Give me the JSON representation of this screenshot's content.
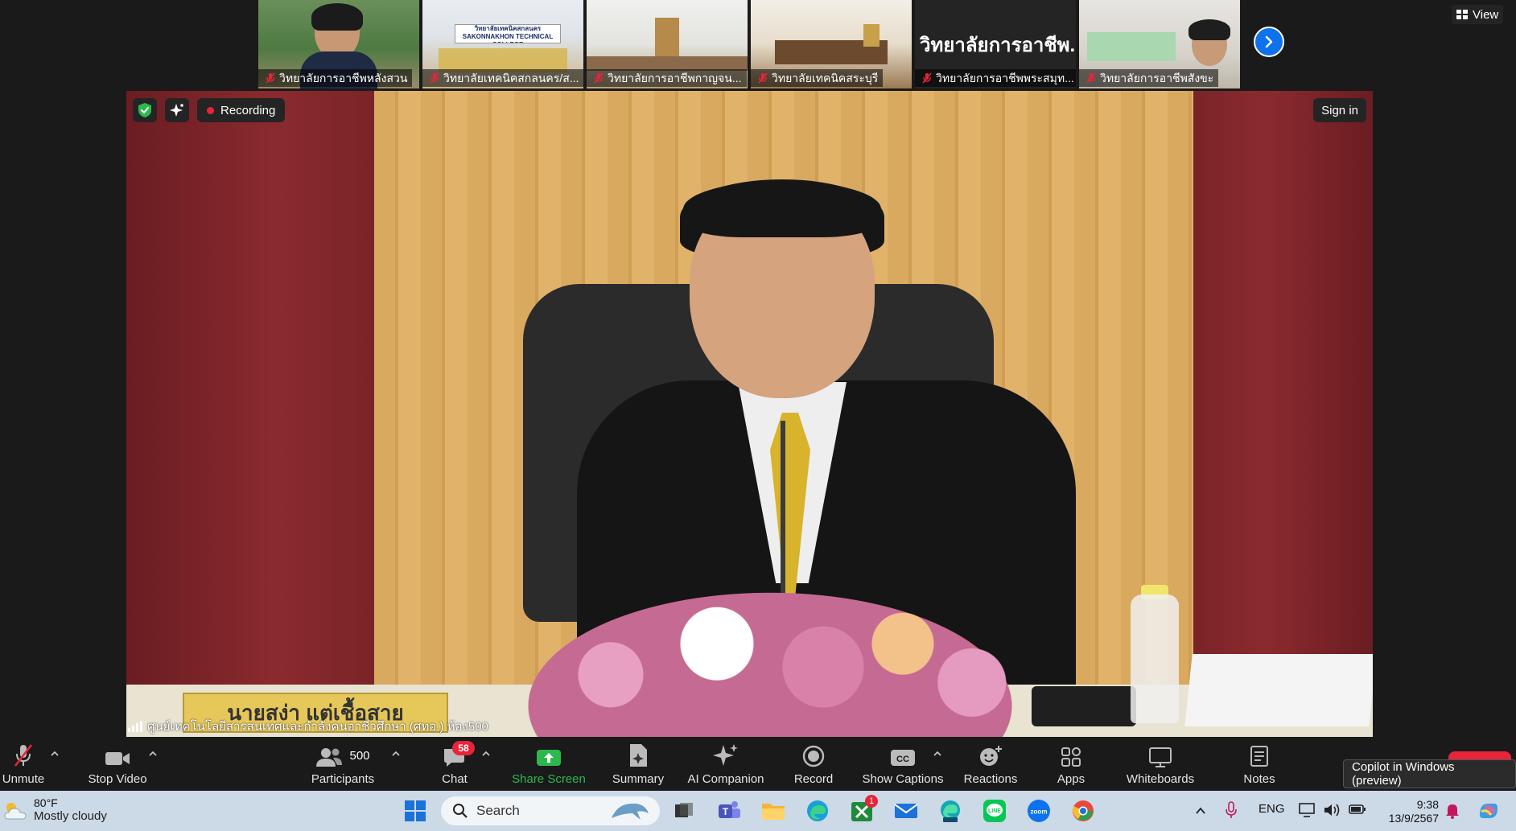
{
  "thumbnails": [
    {
      "label": "วิทยาลัยการอาชีพหลังสวน",
      "muted": true
    },
    {
      "label": "วิทยาลัยเทคนิคสกลนคร/ส...",
      "muted": true
    },
    {
      "label": "วิทยาลัยการอาชีพกาญจน...",
      "muted": true
    },
    {
      "label": "วิทยาลัยเทคนิคสระบุรี",
      "muted": true
    },
    {
      "label": "วิทยาลัยการอาชีพพระสมุท...",
      "muted": true,
      "big_name": "วิทยาลัยการอาชีพ..."
    },
    {
      "label": "วิทยาลัยการอาชีพสังขะ",
      "muted": true
    }
  ],
  "thumb_scene_texts": {
    "sakon_sign": "วิทยาลัยเทคนิคสกลนคร",
    "sakon_sign_en": "SAKONNAKHON TECHNICAL COLLEGE"
  },
  "view_button": "View",
  "main_video": {
    "recording_label": "Recording",
    "sign_in_label": "Sign in",
    "room_label": "ศูนย์เทคโนโลยีสารสนเทศและกำลังคนอาชีวศึกษา (ศทอ.) ห้อง500",
    "nameplate_text": "นายสง่า แต่เชื้อสาย"
  },
  "toolbar": {
    "unmute": "Unmute",
    "stop_video": "Stop Video",
    "participants": "Participants",
    "participants_count": "500",
    "chat": "Chat",
    "chat_badge": "58",
    "share_screen": "Share Screen",
    "summary": "Summary",
    "ai_companion": "AI Companion",
    "record": "Record",
    "show_captions": "Show Captions",
    "reactions": "Reactions",
    "apps": "Apps",
    "whiteboards": "Whiteboards",
    "notes": "Notes",
    "copilot_tooltip": "Copilot in Windows (preview)"
  },
  "taskbar": {
    "weather_temp": "80°F",
    "weather_desc": "Mostly cloudy",
    "search_placeholder": "Search",
    "teams_badge": "1",
    "language": "ENG",
    "time": "9:38",
    "date": "13/9/2567"
  },
  "colors": {
    "zoom_blue": "#0e72ed",
    "recording_red": "#e8243a",
    "share_green": "#2db84d",
    "toolbar_bg": "#1a1a1a",
    "taskbar_bg": "#ccd9e6"
  }
}
